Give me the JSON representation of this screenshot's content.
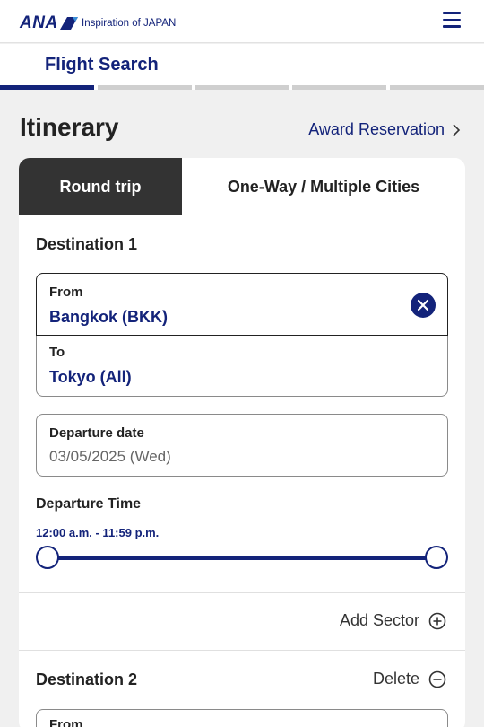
{
  "header": {
    "logo": "ANA",
    "tagline": "Inspiration of JAPAN",
    "menu_icon": "hamburger-menu-icon"
  },
  "subnav": {
    "title": "Flight Search",
    "steps_total": 5,
    "active_step": 1
  },
  "itinerary": {
    "title": "Itinerary",
    "award_link": "Award Reservation"
  },
  "tabs": {
    "round_trip": "Round trip",
    "one_way": "One-Way / Multiple Cities",
    "active": "round_trip"
  },
  "destination1": {
    "heading": "Destination 1",
    "from_label": "From",
    "from_value": "Bangkok (BKK)",
    "to_label": "To",
    "to_value": "Tokyo (All)",
    "date_label": "Departure date",
    "date_value": "03/05/2025 (Wed)",
    "time_label": "Departure Time",
    "time_range": "12:00 a.m. - 11:59 p.m.",
    "time_slider_min": 0,
    "time_slider_max": 1
  },
  "actions": {
    "add_sector": "Add Sector",
    "delete": "Delete"
  },
  "destination2": {
    "heading": "Destination 2",
    "from_label": "From"
  },
  "colors": {
    "brand_navy": "#13237a",
    "tab_active_bg": "#333333",
    "page_bg": "#f0f0f0"
  }
}
